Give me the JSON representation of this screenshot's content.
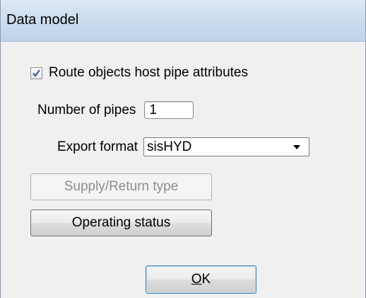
{
  "window": {
    "title": "Data model"
  },
  "form": {
    "route_objects": {
      "label": "Route objects host pipe attributes",
      "checked": true
    },
    "number_of_pipes": {
      "label": "Number of pipes",
      "value": "1"
    },
    "export_format": {
      "label": "Export format",
      "selected": "sisHYD"
    },
    "supply_return_button": {
      "label": "Supply/Return type",
      "enabled": false
    },
    "operating_status_button": {
      "label": "Operating status"
    },
    "ok_button": {
      "label": "OK",
      "mnemonic": "O",
      "rest": "K"
    }
  },
  "colors": {
    "titlebar": "#c9dbee",
    "disabled_text": "#8d8d8d",
    "check": "#3d5a99"
  }
}
